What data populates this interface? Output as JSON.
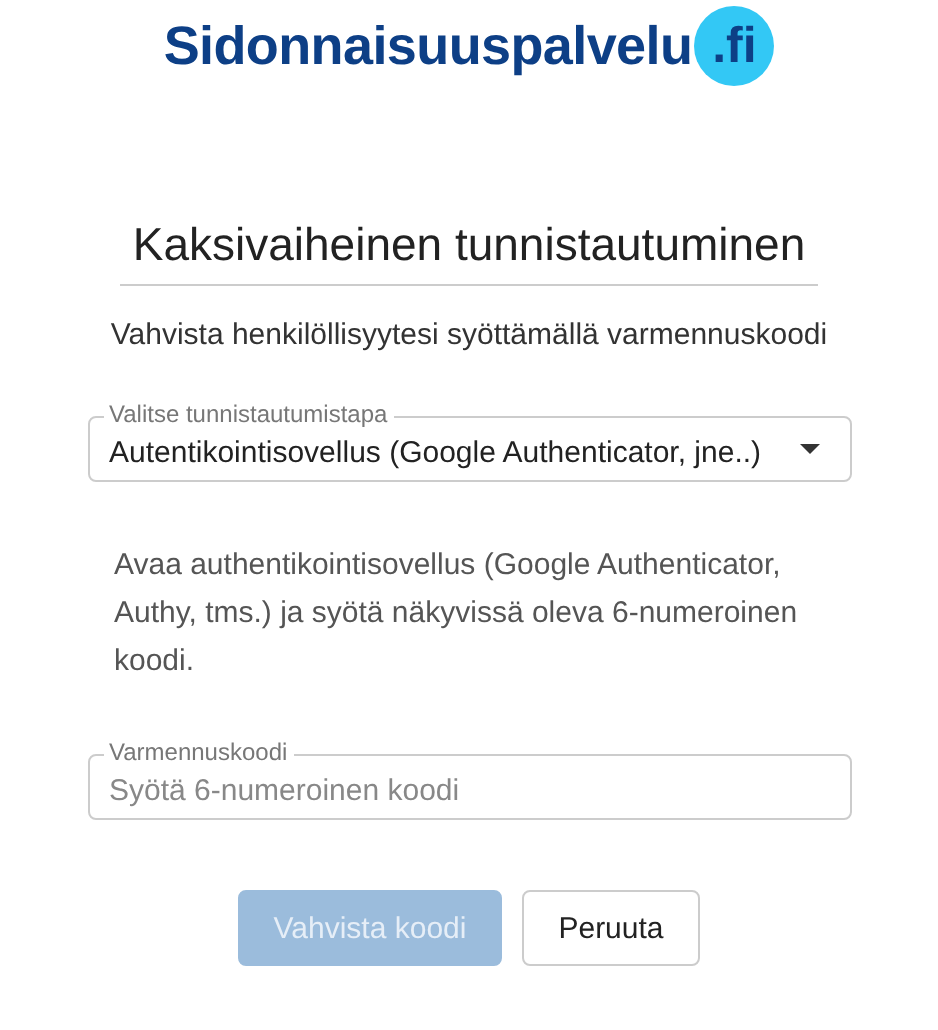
{
  "logo": {
    "name": "Sidonnaisuuspalvelu",
    "domain": ".fi"
  },
  "title": "Kaksivaiheinen tunnistautuminen",
  "subtitle": "Vahvista henkilöllisyytesi syöttämällä varmennuskoodi",
  "method_select": {
    "label": "Valitse tunnistautumistapa",
    "value": "Autentikointisovellus (Google Authenticator, jne..)"
  },
  "instructions": "Avaa authentikointisovellus (Google Authenticator, Authy, tms.) ja syötä näkyvissä oleva 6-numeroinen koodi.",
  "code_field": {
    "label": "Varmennuskoodi",
    "placeholder": "Syötä 6-numeroinen koodi"
  },
  "buttons": [
    {
      "label": "Vahvista koodi",
      "kind": "primary",
      "disabled": true
    },
    {
      "label": "Peruuta",
      "kind": "secondary",
      "disabled": false
    }
  ]
}
